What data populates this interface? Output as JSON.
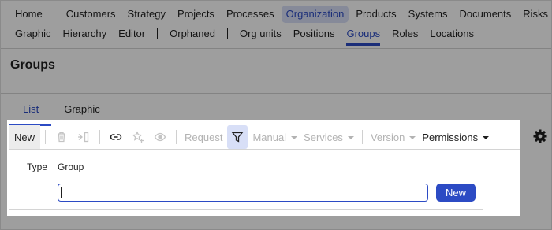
{
  "nav": {
    "primary": [
      {
        "label": "Home"
      },
      {
        "label": "Customers"
      },
      {
        "label": "Strategy"
      },
      {
        "label": "Projects"
      },
      {
        "label": "Processes"
      },
      {
        "label": "Organization"
      },
      {
        "label": "Products"
      },
      {
        "label": "Systems"
      },
      {
        "label": "Documents"
      },
      {
        "label": "Risks"
      }
    ],
    "secondary": [
      {
        "label": "Graphic"
      },
      {
        "label": "Hierarchy"
      },
      {
        "label": "Editor"
      },
      {
        "label": "Orphaned"
      },
      {
        "label": "Org units"
      },
      {
        "label": "Positions"
      },
      {
        "label": "Groups"
      },
      {
        "label": "Roles"
      },
      {
        "label": "Locations"
      }
    ]
  },
  "page": {
    "title": "Groups"
  },
  "subtabs": [
    {
      "label": "List"
    },
    {
      "label": "Graphic"
    }
  ],
  "toolbar": {
    "new_label": "New",
    "request_label": "Request",
    "manual_label": "Manual",
    "services_label": "Services",
    "version_label": "Version",
    "permissions_label": "Permissions"
  },
  "form": {
    "type_label": "Type",
    "type_value": "Group",
    "name_value": "",
    "submit_label": "New"
  },
  "colors": {
    "accent": "#2c4bc4",
    "accent_soft": "#d8dff7",
    "disabled": "#b3b3b3",
    "overlay": "rgba(0,0,0,0.38)"
  }
}
